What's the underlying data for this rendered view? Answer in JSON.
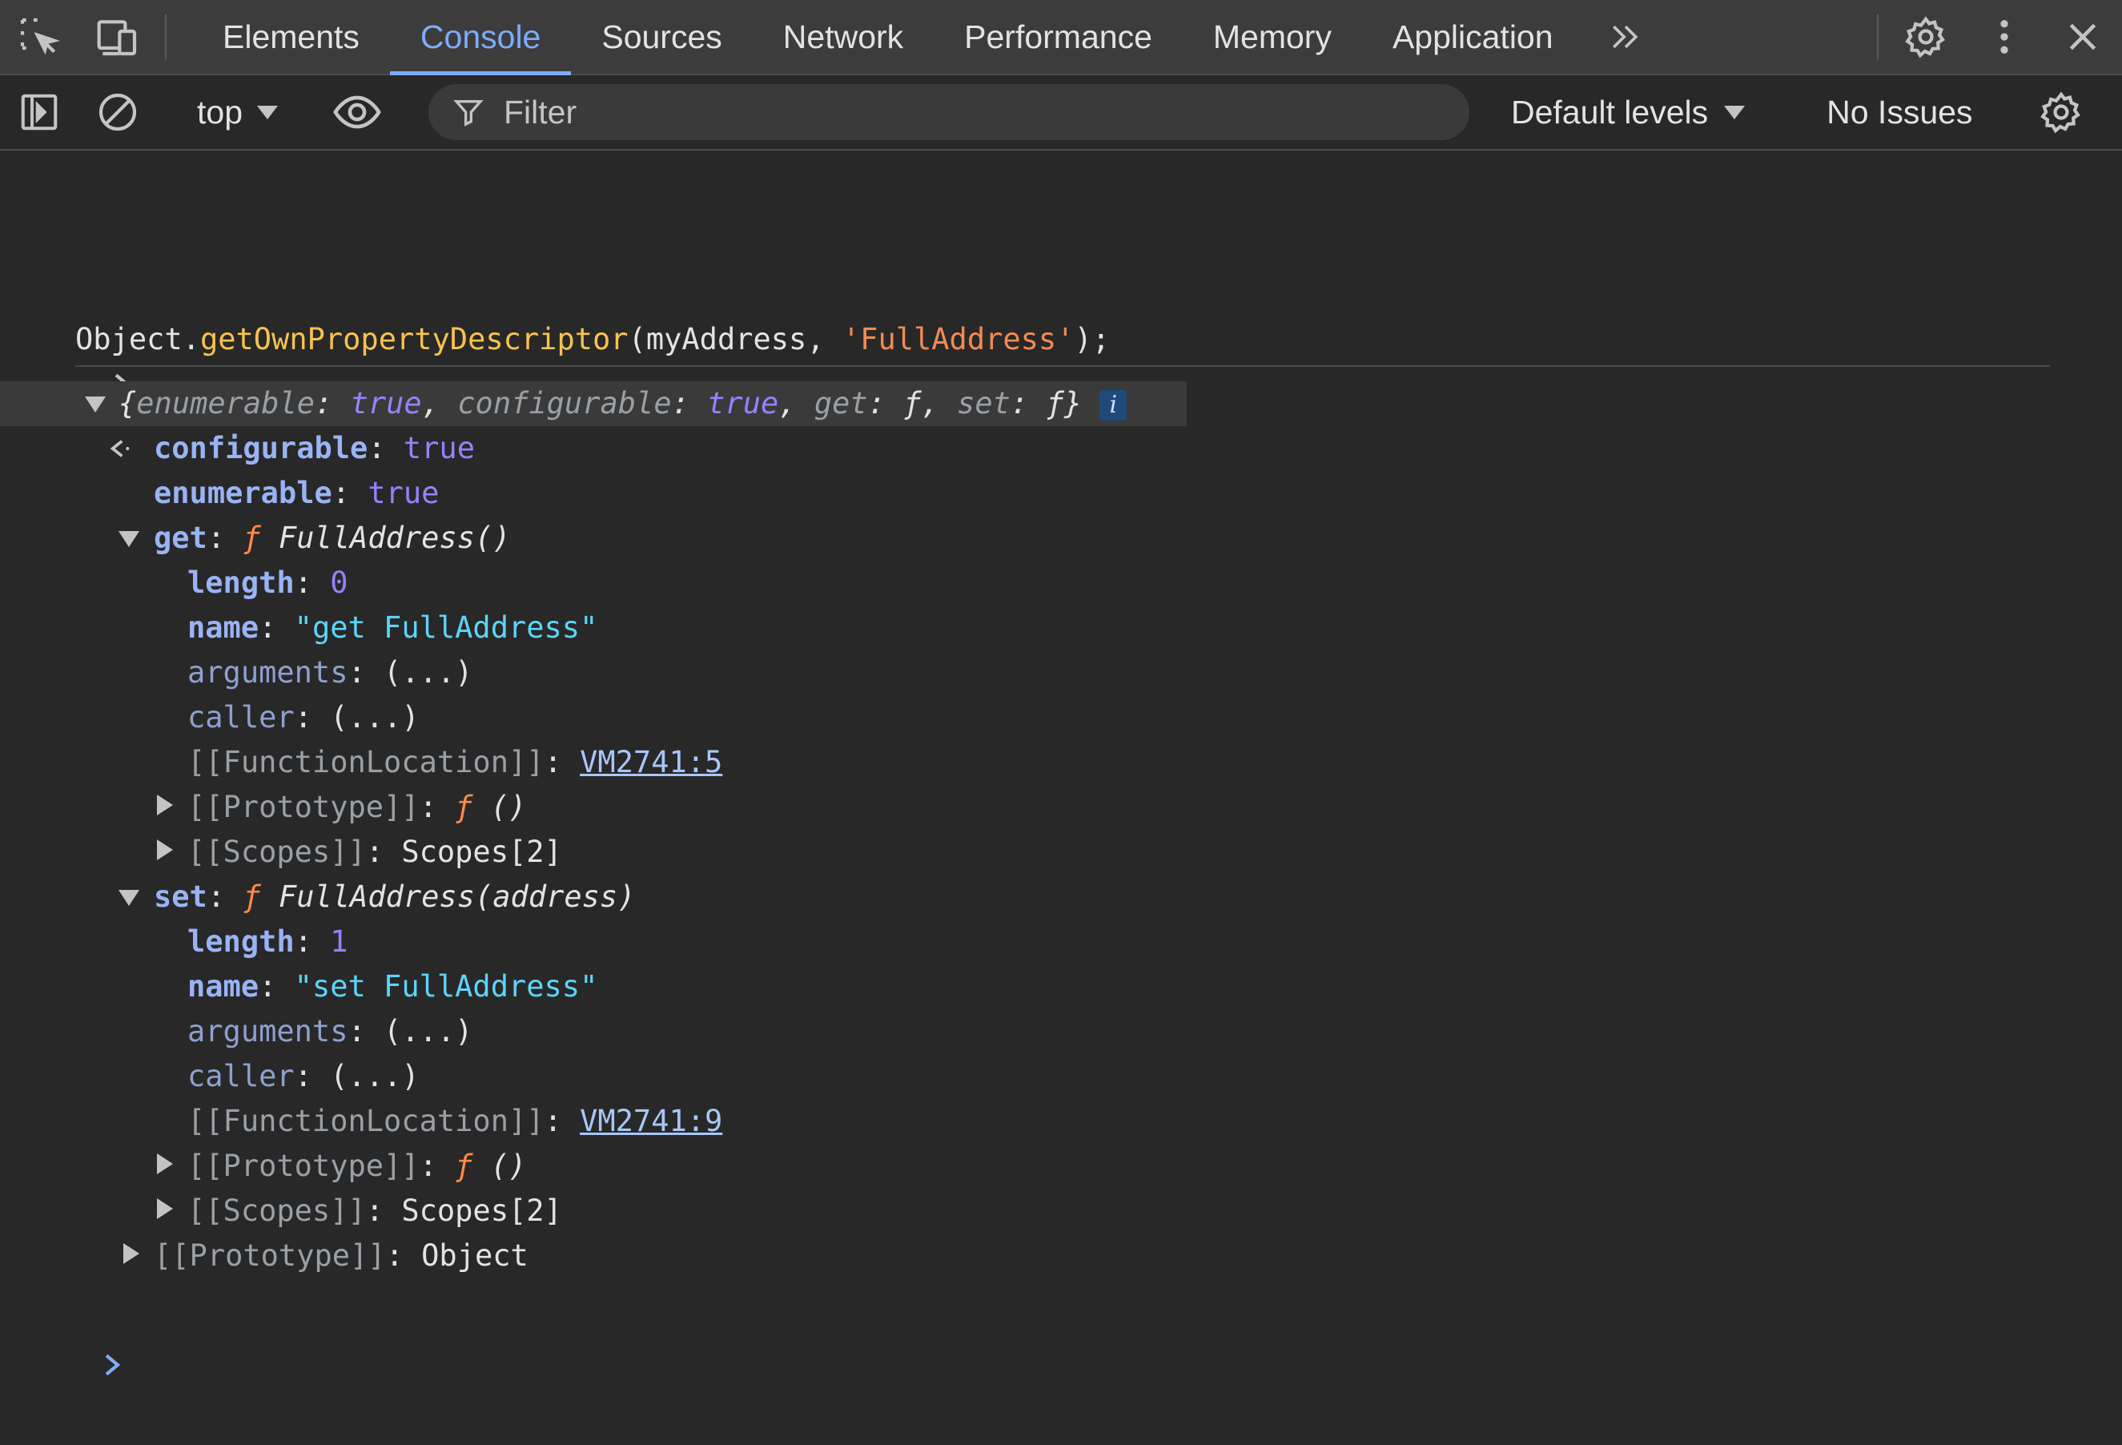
{
  "tabs": [
    "Elements",
    "Console",
    "Sources",
    "Network",
    "Performance",
    "Memory",
    "Application"
  ],
  "active_tab": "Console",
  "toolbar": {
    "context": "top",
    "filter_placeholder": "Filter",
    "levels": "Default levels",
    "issues": "No Issues"
  },
  "console": {
    "input": {
      "obj": "Object",
      "dot": ".",
      "method": "getOwnPropertyDescriptor",
      "open": "(",
      "arg1": "myAddress",
      "comma": ", ",
      "arg2": "'FullAddress'",
      "close": ");"
    },
    "summary": {
      "open": "{",
      "k1": "enumerable",
      "v1": "true",
      "k2": "configurable",
      "v2": "true",
      "k3": "get",
      "v3": "ƒ",
      "k4": "set",
      "v4": "ƒ",
      "close": "}",
      "info": "i"
    },
    "configurable": {
      "key": "configurable",
      "value": "true"
    },
    "enumerable": {
      "key": "enumerable",
      "value": "true"
    },
    "get": {
      "key": "get",
      "f": "ƒ",
      "sig": "FullAddress()",
      "length_key": "length",
      "length_val": "0",
      "name_key": "name",
      "name_val": "\"get FullAddress\"",
      "args_key": "arguments",
      "args_val": "(...)",
      "caller_key": "caller",
      "caller_val": "(...)",
      "loc_key": "[[FunctionLocation]]",
      "loc_val": "VM2741:5",
      "proto_key": "[[Prototype]]",
      "proto_f": "ƒ",
      "proto_val": "()",
      "scopes_key": "[[Scopes]]",
      "scopes_val": "Scopes[2]"
    },
    "set": {
      "key": "set",
      "f": "ƒ",
      "sig": "FullAddress(address)",
      "length_key": "length",
      "length_val": "1",
      "name_key": "name",
      "name_val": "\"set FullAddress\"",
      "args_key": "arguments",
      "args_val": "(...)",
      "caller_key": "caller",
      "caller_val": "(...)",
      "loc_key": "[[FunctionLocation]]",
      "loc_val": "VM2741:9",
      "proto_key": "[[Prototype]]",
      "proto_f": "ƒ",
      "proto_val": "()",
      "scopes_key": "[[Scopes]]",
      "scopes_val": "Scopes[2]"
    },
    "prototype": {
      "key": "[[Prototype]]",
      "value": "Object"
    }
  },
  "colors": {
    "background": "#282828",
    "accent": "#7cacf8",
    "key": "#99b4f5",
    "string": "#5cd5fb",
    "number": "#9980ff",
    "function": "#ff8a4a"
  }
}
